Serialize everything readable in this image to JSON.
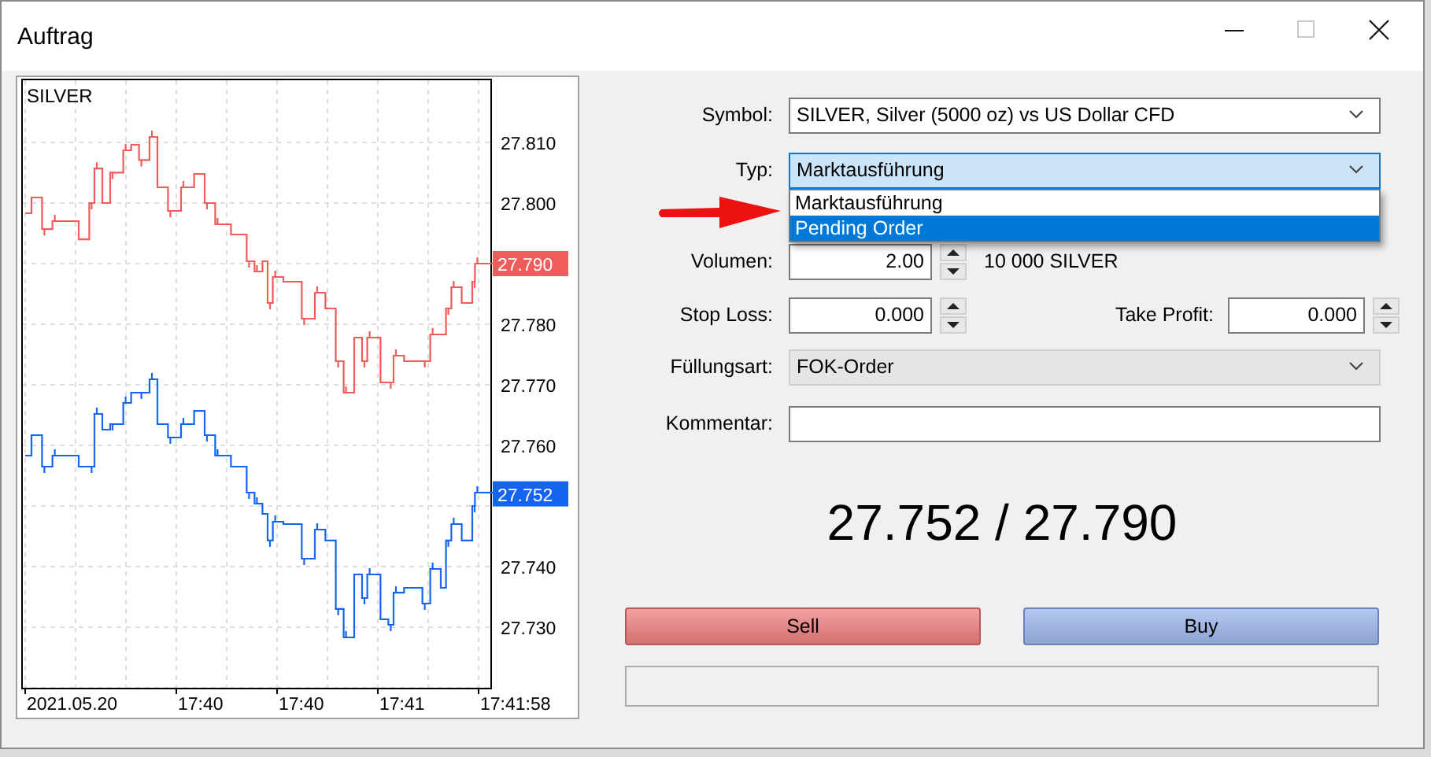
{
  "window": {
    "title": "Auftrag",
    "maximize_disabled": true
  },
  "chart": {
    "title": "SILVER",
    "y_labels": [
      "27.810",
      "27.800",
      "27.780",
      "27.770",
      "27.760",
      "27.740",
      "27.730"
    ],
    "x_labels": [
      "2021.05.20",
      "17:40",
      "17:40",
      "17:41",
      "17:41:58"
    ],
    "price_tags": [
      {
        "text": "27.790",
        "color": "#f05b5b"
      },
      {
        "text": "27.752",
        "color": "#1464f0"
      }
    ]
  },
  "form": {
    "fields": [
      {
        "kind": "select",
        "label": "Symbol:",
        "value": "SILVER, Silver (5000 oz) vs US Dollar CFD",
        "focused": false,
        "expanded": false,
        "disabled": false
      },
      {
        "kind": "select",
        "label": "Typ:",
        "value": "Marktausführung",
        "focused": true,
        "expanded": true,
        "disabled": false,
        "options": [
          {
            "label": "Marktausführung",
            "highlighted": false
          },
          {
            "label": "Pending Order",
            "highlighted": true
          }
        ]
      },
      {
        "kind": "spin",
        "label": "Volumen:",
        "value": "2.00",
        "note": "10 000 SILVER"
      },
      {
        "kind": "spin_pair",
        "label": "Stop Loss:",
        "value": "0.000",
        "label2": "Take Profit:",
        "value2": "0.000"
      },
      {
        "kind": "select",
        "label": "Füllungsart:",
        "value": "FOK-Order",
        "focused": false,
        "expanded": false,
        "disabled": true
      },
      {
        "kind": "text",
        "label": "Kommentar:"
      }
    ]
  },
  "prices": "27.752 / 27.790",
  "buttons": [
    {
      "kind": "sell",
      "label": "Sell"
    },
    {
      "kind": "buy",
      "label": "Buy"
    }
  ]
}
